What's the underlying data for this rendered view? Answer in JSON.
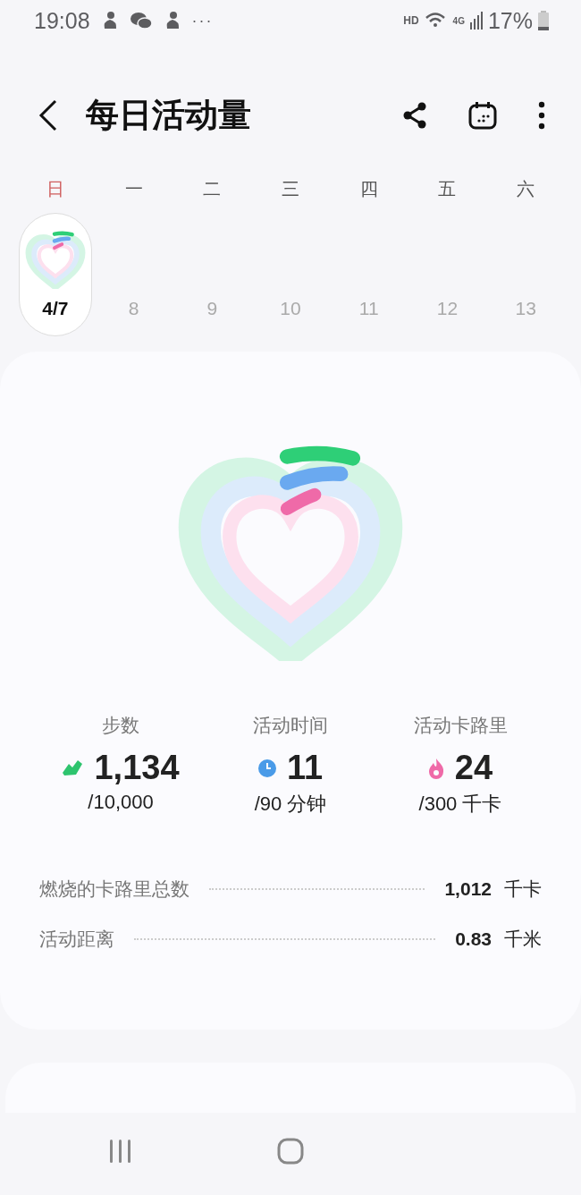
{
  "status_bar": {
    "time": "19:08",
    "more": "···",
    "hd": "HD",
    "network": "4G",
    "battery": "17%"
  },
  "header": {
    "title": "每日活动量"
  },
  "week": [
    {
      "weekday": "日",
      "date": "4/7",
      "selected": true
    },
    {
      "weekday": "一",
      "date": "8",
      "selected": false
    },
    {
      "weekday": "二",
      "date": "9",
      "selected": false
    },
    {
      "weekday": "三",
      "date": "10",
      "selected": false
    },
    {
      "weekday": "四",
      "date": "11",
      "selected": false
    },
    {
      "weekday": "五",
      "date": "12",
      "selected": false
    },
    {
      "weekday": "六",
      "date": "13",
      "selected": false
    }
  ],
  "summary": {
    "stats": [
      {
        "kind": "steps",
        "label": "步数",
        "value": "1,134",
        "goal": "/10,000",
        "color": "#2ec46e"
      },
      {
        "kind": "time",
        "label": "活动时间",
        "value": "11",
        "goal": "/90 分钟",
        "color": "#4a9be8"
      },
      {
        "kind": "calories",
        "label": "活动卡路里",
        "value": "24",
        "goal": "/300 千卡",
        "color": "#ef6aa8"
      }
    ],
    "details": [
      {
        "label": "燃烧的卡路里总数",
        "value": "1,012",
        "unit": "千卡"
      },
      {
        "label": "活动距离",
        "value": "0.83",
        "unit": "千米"
      }
    ]
  }
}
